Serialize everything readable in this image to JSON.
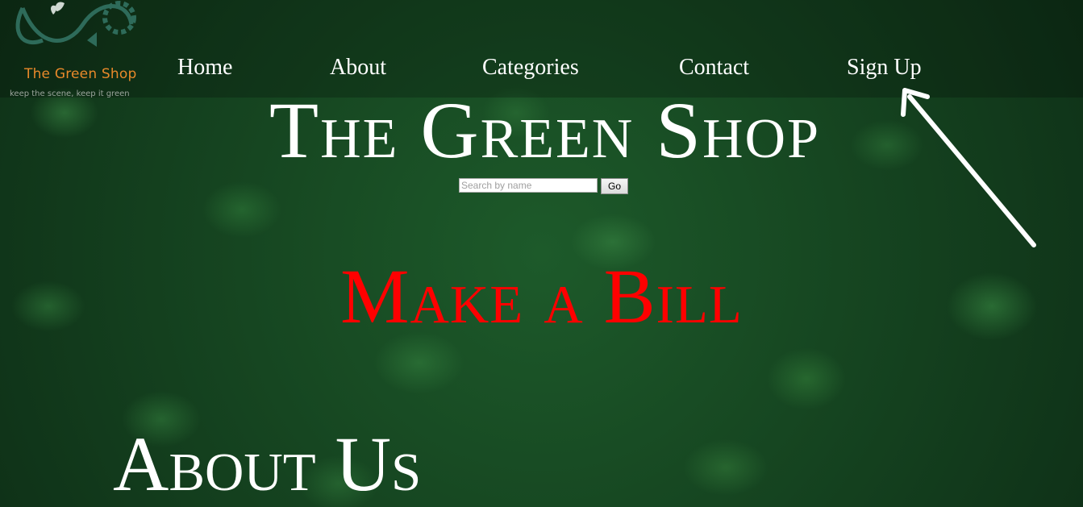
{
  "logo": {
    "name": "The Green Shop",
    "tagline": "keep the scene, keep it green"
  },
  "nav": {
    "items": [
      {
        "label": "Home"
      },
      {
        "label": "About"
      },
      {
        "label": "Categories"
      },
      {
        "label": "Contact"
      },
      {
        "label": "Sign Up"
      }
    ]
  },
  "hero": {
    "title": "The Green Shop"
  },
  "search": {
    "placeholder": "Search by name",
    "value": "",
    "button_label": "Go"
  },
  "make_bill": {
    "label": "Make a Bill",
    "color": "#ff0000"
  },
  "about": {
    "heading": "About Us"
  },
  "annotation": {
    "icon": "arrow-icon",
    "color": "#ffffff"
  },
  "colors": {
    "logo_text": "#e8892a",
    "nav_text": "#ffffff",
    "background": "#1d5a2a"
  }
}
